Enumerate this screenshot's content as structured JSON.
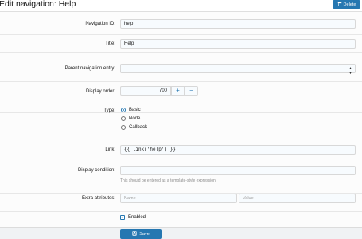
{
  "header": {
    "title": "Edit navigation: Help",
    "delete_label": "Delete"
  },
  "form": {
    "navigation_id": {
      "label": "Navigation ID:",
      "value": "help"
    },
    "title": {
      "label": "Title:",
      "value": "Help"
    },
    "parent": {
      "label": "Parent navigation entry:",
      "value": ""
    },
    "display_order": {
      "label": "Display order:",
      "value": "700",
      "plus": "+",
      "minus": "−"
    },
    "type": {
      "label": "Type:",
      "options": [
        {
          "label": "Basic",
          "checked": true
        },
        {
          "label": "Node",
          "checked": false
        },
        {
          "label": "Callback",
          "checked": false
        }
      ]
    },
    "link": {
      "label": "Link:",
      "value": "{{ link('help') }}"
    },
    "display_condition": {
      "label": "Display condition:",
      "value": "",
      "hint": "This should be entered as a template-style expression."
    },
    "extra_attributes": {
      "label": "Extra attributes:",
      "name_placeholder": "Name",
      "value_placeholder": "Value"
    },
    "enabled": {
      "label": "Enabled",
      "checked": true
    }
  },
  "footer": {
    "save_label": "Save"
  },
  "colors": {
    "accent": "#2577b1",
    "field_bg": "#f7fbfe",
    "footer_bg": "#f0f2f4"
  }
}
